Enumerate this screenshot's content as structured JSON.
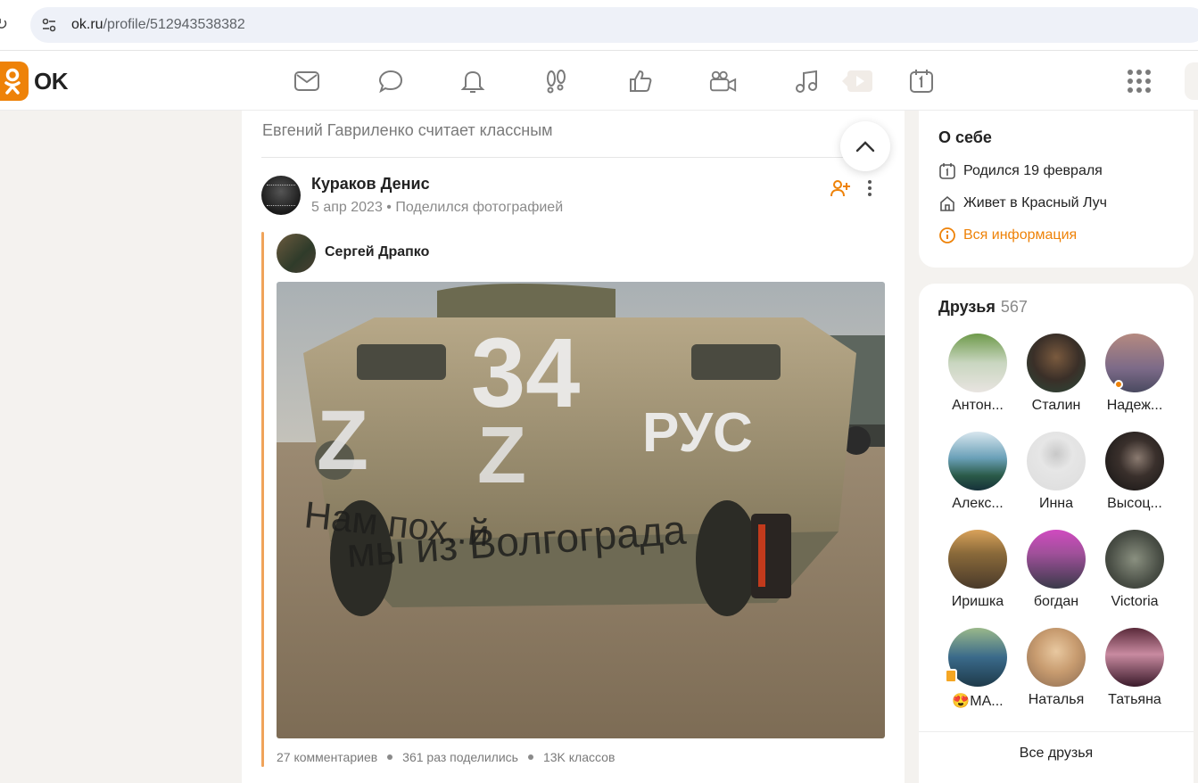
{
  "browser": {
    "url_host": "ok.ru",
    "url_path": "/profile/512943538382"
  },
  "header": {
    "logo_text": "OK",
    "nav_icons": [
      "mail-icon",
      "chat-icon",
      "bell-icon",
      "guests-footprints-icon",
      "likes-thumb-icon",
      "video-camera-icon",
      "music-note-icon",
      "video-play-icon",
      "calendar-icon",
      "apps-grid-icon"
    ],
    "accent": "#ee8208"
  },
  "feed": {
    "liker_line": "Евгений Гавриленко считает классным",
    "post": {
      "author": "Кураков Денис",
      "date": "5 апр 2023",
      "action": "Поделился фотографией",
      "original_author": "Сергей Драпко",
      "stats": {
        "comments": "27 комментариев",
        "shares": "361 раз поделились",
        "likes": "13K классов"
      }
    }
  },
  "about": {
    "title": "О себе",
    "birthday": "Родился 19 февраля",
    "city": "Живет в Красный Луч",
    "more_info": "Вся информация"
  },
  "friends": {
    "title": "Друзья",
    "count": "567",
    "items": [
      {
        "name": "Антон..."
      },
      {
        "name": "Сталин"
      },
      {
        "name": "Надеж..."
      },
      {
        "name": "Алекс..."
      },
      {
        "name": "Инна"
      },
      {
        "name": "Высоц..."
      },
      {
        "name": "Иришка"
      },
      {
        "name": "богдан"
      },
      {
        "name": "Victoria"
      },
      {
        "name": "😍МА..."
      },
      {
        "name": "Наталья"
      },
      {
        "name": "Татьяна"
      }
    ],
    "all_label": "Все друзья"
  }
}
